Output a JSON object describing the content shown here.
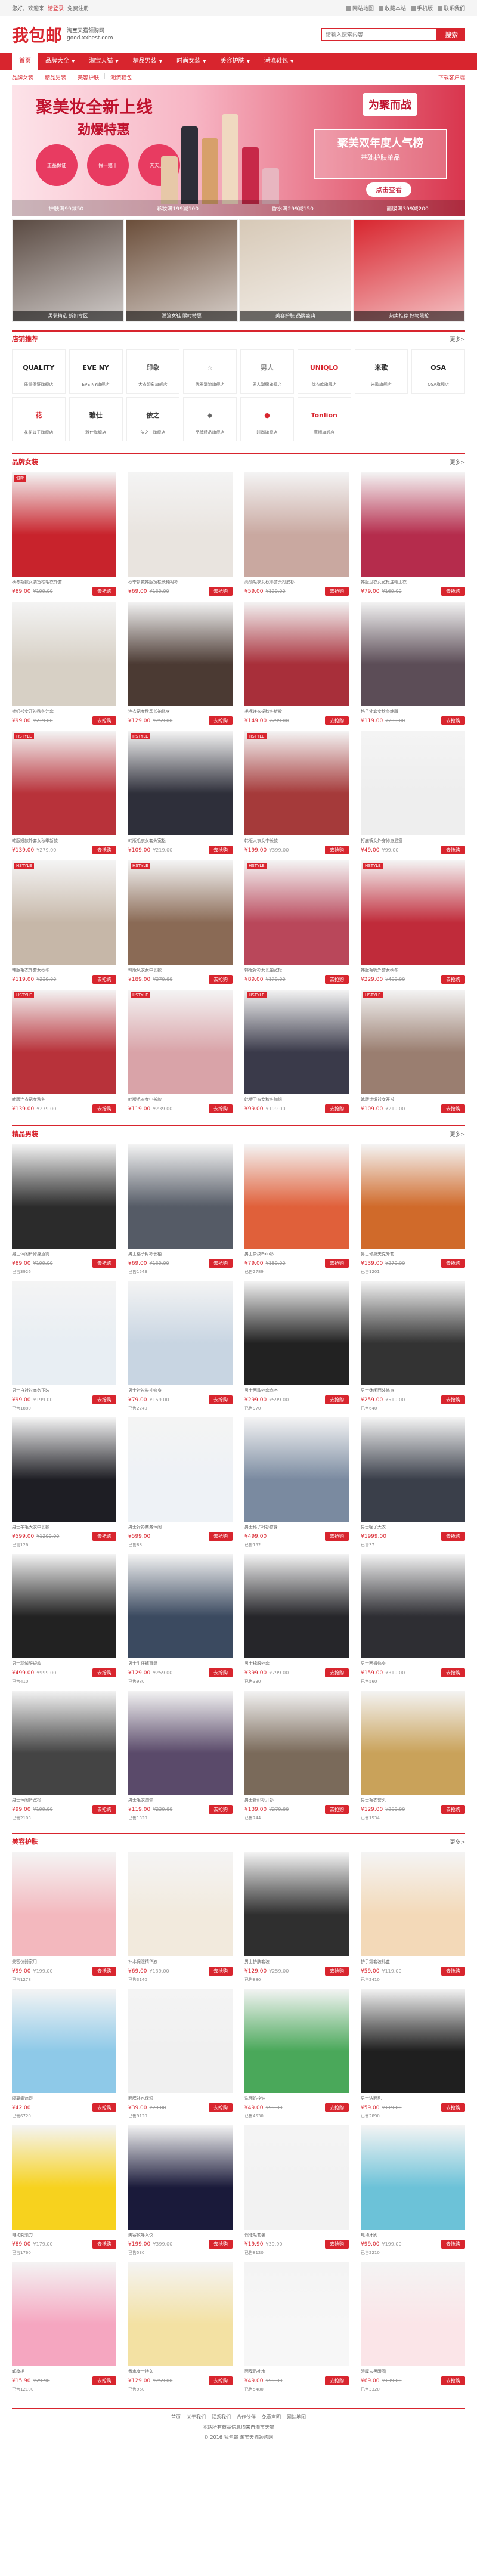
{
  "topbar": {
    "greeting": "您好，欢迎来",
    "login": "请登录",
    "register": "免费注册",
    "right_links": [
      "网站地图",
      "收藏本站",
      "手机版",
      "联系我们"
    ]
  },
  "header": {
    "logo": "我包邮",
    "subtitle1": "淘宝天猫领购网",
    "subtitle2": "good.xxbest.com",
    "search_placeholder": "请输入搜索内容",
    "search_button": "搜索"
  },
  "nav": {
    "items": [
      {
        "label": "首页",
        "active": true
      },
      {
        "label": "品牌大全",
        "active": false
      },
      {
        "label": "淘宝天猫",
        "active": false
      },
      {
        "label": "精品男装",
        "active": false
      },
      {
        "label": "时尚女装",
        "active": false
      },
      {
        "label": "美容护肤",
        "active": false
      },
      {
        "label": "潮流鞋包",
        "active": false
      }
    ]
  },
  "subnav": {
    "crumbs": [
      "品牌女装",
      "精品男装",
      "美容护肤",
      "潮流鞋包"
    ],
    "right": "下载客户端"
  },
  "banner": {
    "headline": "聚美妆全新上线",
    "subline": "劲爆特惠",
    "badges": [
      "正品保证",
      "假一赔十",
      "天天上新"
    ],
    "brand_tag": "为聚而战",
    "rank_line1": "聚美双年度人气榜",
    "rank_line2": "基础护肤单品",
    "cta": "点击查看",
    "strip": [
      "护肤满99减50",
      "彩妆满199减100",
      "香水满299减150",
      "面膜满399减200"
    ]
  },
  "promos": [
    {
      "label": "男装精选 折扣专区",
      "color": "#5a4a42"
    },
    {
      "label": "潮流女鞋 限时特惠",
      "color": "#6b4e3a"
    },
    {
      "label": "美容护肤 品牌盛典",
      "color": "#d7c9b7"
    },
    {
      "label": "热卖推荐 好物限抢",
      "color": "#d8252e"
    }
  ],
  "brand_section": {
    "title": "店铺推荐",
    "more": "更多>",
    "brands": [
      {
        "logo": "QUALITY",
        "name": "质量保证旗舰店",
        "color": "#222"
      },
      {
        "logo": "EVE NY",
        "name": "EVE NY旗舰店",
        "color": "#222"
      },
      {
        "logo": "印象",
        "name": "大衣印象旗舰店",
        "color": "#555"
      },
      {
        "logo": "☆",
        "name": "优雅潮流旗舰店",
        "color": "#888"
      },
      {
        "logo": "男人",
        "name": "男人潮牌旗舰店",
        "color": "#888"
      },
      {
        "logo": "UNIQLO",
        "name": "优衣库旗舰店",
        "color": "#d8252e"
      },
      {
        "logo": "米歌",
        "name": "米歌旗舰店",
        "color": "#222"
      },
      {
        "logo": "OSA",
        "name": "OSA旗舰店",
        "color": "#222"
      },
      {
        "logo": "花",
        "name": "花花公子旗舰店",
        "color": "#d8252e"
      },
      {
        "logo": "雅仕",
        "name": "雅仕旗舰店",
        "color": "#333"
      },
      {
        "logo": "依之",
        "name": "依之一旗舰店",
        "color": "#444"
      },
      {
        "logo": "◆",
        "name": "品牌精品旗舰店",
        "color": "#666"
      },
      {
        "logo": "●",
        "name": "时尚旗舰店",
        "color": "#d8252e"
      },
      {
        "logo": "Tonlion",
        "name": "唐狮旗舰店",
        "color": "#d8252e"
      }
    ]
  },
  "women": {
    "title": "品牌女装",
    "more": "更多>",
    "products": [
      {
        "title": "秋冬新款女装宽松毛衣外套",
        "price": "¥89.00",
        "old": "¥199.00",
        "color": "#c8232c",
        "tag": "包邮"
      },
      {
        "title": "秋季新款韩版宽松长袖衬衫",
        "price": "¥69.00",
        "old": "¥139.00",
        "color": "#e9e4df",
        "tag": ""
      },
      {
        "title": "高领毛衣女秋冬套头打底衫",
        "price": "¥59.00",
        "old": "¥129.00",
        "color": "#c9a8a0",
        "tag": ""
      },
      {
        "title": "韩版卫衣女宽松连帽上衣",
        "price": "¥79.00",
        "old": "¥169.00",
        "color": "#b52c4c",
        "tag": ""
      },
      {
        "title": "针织衫女开衫秋冬外套",
        "price": "¥99.00",
        "old": "¥219.00",
        "color": "#d7d0c5",
        "tag": ""
      },
      {
        "title": "连衣裙女秋季长袖修身",
        "price": "¥129.00",
        "old": "¥259.00",
        "color": "#4b3a33",
        "tag": ""
      },
      {
        "title": "毛呢连衣裙秋冬新款",
        "price": "¥149.00",
        "old": "¥299.00",
        "color": "#a82f3a",
        "tag": ""
      },
      {
        "title": "格子外套女秋冬韩版",
        "price": "¥119.00",
        "old": "¥239.00",
        "color": "#5c4d57",
        "tag": ""
      },
      {
        "title": "韩版短款外套女秋季新款",
        "price": "¥139.00",
        "old": "¥279.00",
        "color": "#b8323a",
        "tag": "HSTYLE"
      },
      {
        "title": "韩版毛衣女套头宽松",
        "price": "¥109.00",
        "old": "¥219.00",
        "color": "#2e2f3a",
        "tag": "HSTYLE"
      },
      {
        "title": "韩版大衣女中长款",
        "price": "¥199.00",
        "old": "¥399.00",
        "color": "#a53a3a",
        "tag": "HSTYLE"
      },
      {
        "title": "打底裤女外穿修身显瘦",
        "price": "¥49.00",
        "old": "¥99.00",
        "color": "#eeeeee",
        "tag": ""
      },
      {
        "title": "韩版毛衣外套女秋冬",
        "price": "¥119.00",
        "old": "¥239.00",
        "color": "#c6b7a8",
        "tag": "HSTYLE"
      },
      {
        "title": "韩版风衣女中长款",
        "price": "¥189.00",
        "old": "¥379.00",
        "color": "#8a6a55",
        "tag": "HSTYLE"
      },
      {
        "title": "韩版衬衫女长袖宽松",
        "price": "¥89.00",
        "old": "¥179.00",
        "color": "#b9475a",
        "tag": "HSTYLE"
      },
      {
        "title": "韩版毛呢外套女秋冬",
        "price": "¥229.00",
        "old": "¥459.00",
        "color": "#c02b3a",
        "tag": "HSTYLE"
      },
      {
        "title": "韩版连衣裙女秋冬",
        "price": "¥139.00",
        "old": "¥279.00",
        "color": "#b8323a",
        "tag": "HSTYLE"
      },
      {
        "title": "韩版毛衣女中长款",
        "price": "¥119.00",
        "old": "¥239.00",
        "color": "#d9a3a8",
        "tag": "HSTYLE"
      },
      {
        "title": "韩版卫衣女秋冬加绒",
        "price": "¥99.00",
        "old": "¥199.00",
        "color": "#3a3a4a",
        "tag": "HSTYLE"
      },
      {
        "title": "韩版针织衫女开衫",
        "price": "¥109.00",
        "old": "¥219.00",
        "color": "#9a7e70",
        "tag": "HSTYLE"
      }
    ]
  },
  "men": {
    "title": "精品男装",
    "more": "更多>",
    "products": [
      {
        "title": "男士休闲裤修身直筒",
        "price": "¥89.00",
        "old": "¥199.00",
        "sold": "已售3926",
        "color": "#2b2b2b"
      },
      {
        "title": "男士格子衬衫长袖",
        "price": "¥69.00",
        "old": "¥139.00",
        "sold": "已售1543",
        "color": "#555b66"
      },
      {
        "title": "男士条纹Polo衫",
        "price": "¥79.00",
        "old": "¥159.00",
        "sold": "已售2789",
        "color": "#e0603a"
      },
      {
        "title": "男士修身夹克外套",
        "price": "¥139.00",
        "old": "¥279.00",
        "sold": "已售1201",
        "color": "#d06a2a"
      },
      {
        "title": "男士白衬衫商务正装",
        "price": "¥99.00",
        "old": "¥199.00",
        "sold": "已售1880",
        "color": "#e8eef3"
      },
      {
        "title": "男士衬衫长袖修身",
        "price": "¥79.00",
        "old": "¥159.00",
        "sold": "已售2240",
        "color": "#c8d5e2"
      },
      {
        "title": "男士西装外套商务",
        "price": "¥299.00",
        "old": "¥599.00",
        "sold": "已售970",
        "color": "#222"
      },
      {
        "title": "男士休闲西装修身",
        "price": "¥259.00",
        "old": "¥519.00",
        "sold": "已售640",
        "color": "#333"
      },
      {
        "title": "男士羊毛大衣中长款",
        "price": "¥599.00",
        "old": "¥1299.00",
        "sold": "已售126",
        "color": "#1e1e24"
      },
      {
        "title": "男士衬衫商务休闲",
        "price": "¥599.00",
        "old": "",
        "sold": "已售88",
        "color": "#eef2f6"
      },
      {
        "title": "男士格子衬衫修身",
        "price": "¥499.00",
        "old": "",
        "sold": "已售152",
        "color": "#7a8aa0"
      },
      {
        "title": "男士呢子大衣",
        "price": "¥1999.00",
        "old": "",
        "sold": "已售37",
        "color": "#3a3f4a"
      },
      {
        "title": "男士羽绒服短款",
        "price": "¥499.00",
        "old": "¥999.00",
        "sold": "已售410",
        "color": "#222"
      },
      {
        "title": "男士牛仔裤直筒",
        "price": "¥129.00",
        "old": "¥259.00",
        "sold": "已售980",
        "color": "#3b4a60"
      },
      {
        "title": "男士棉服外套",
        "price": "¥399.00",
        "old": "¥799.00",
        "sold": "已售330",
        "color": "#26262a"
      },
      {
        "title": "男士西裤修身",
        "price": "¥159.00",
        "old": "¥319.00",
        "sold": "已售560",
        "color": "#2e2e33"
      },
      {
        "title": "男士休闲裤宽松",
        "price": "¥99.00",
        "old": "¥199.00",
        "sold": "已售2103",
        "color": "#444"
      },
      {
        "title": "男士毛衣圆领",
        "price": "¥119.00",
        "old": "¥239.00",
        "sold": "已售1320",
        "color": "#5a4a6a"
      },
      {
        "title": "男士针织衫开衫",
        "price": "¥139.00",
        "old": "¥279.00",
        "sold": "已售744",
        "color": "#7a6a5a"
      },
      {
        "title": "男士毛衣套头",
        "price": "¥129.00",
        "old": "¥259.00",
        "sold": "已售1534",
        "color": "#c9a25a"
      }
    ]
  },
  "beauty": {
    "title": "美容护肤",
    "more": "更多>",
    "products": [
      {
        "title": "美容仪器家用",
        "price": "¥99.00",
        "old": "¥199.00",
        "sold": "已售1278",
        "color": "#f3b8be"
      },
      {
        "title": "补水保湿精华液",
        "price": "¥69.00",
        "old": "¥139.00",
        "sold": "已售3140",
        "color": "#f2eadd"
      },
      {
        "title": "男士护肤套装",
        "price": "¥129.00",
        "old": "¥259.00",
        "sold": "已售880",
        "color": "#2f2f2f"
      },
      {
        "title": "护手霜套装礼盒",
        "price": "¥59.00",
        "old": "¥119.00",
        "sold": "已售2410",
        "color": "#f3d9b8"
      },
      {
        "title": "隔离霜遮瑕",
        "price": "¥42.00",
        "old": "",
        "sold": "已售6720",
        "color": "#8ec9e8"
      },
      {
        "title": "面膜补水保湿",
        "price": "¥39.00",
        "old": "¥79.00",
        "sold": "已售9120",
        "color": "#f0f0f0"
      },
      {
        "title": "洗面奶控油",
        "price": "¥49.00",
        "old": "¥99.00",
        "sold": "已售4530",
        "color": "#4aa85a"
      },
      {
        "title": "男士洁面乳",
        "price": "¥59.00",
        "old": "¥119.00",
        "sold": "已售2890",
        "color": "#1f1f1f"
      },
      {
        "title": "电动剃须刀",
        "price": "¥89.00",
        "old": "¥179.00",
        "sold": "已售1760",
        "color": "#f7d21e"
      },
      {
        "title": "美容仪导入仪",
        "price": "¥199.00",
        "old": "¥399.00",
        "sold": "已售530",
        "color": "#1a1a3a"
      },
      {
        "title": "假睫毛套装",
        "price": "¥19.90",
        "old": "¥39.90",
        "sold": "已售8120",
        "color": "#f2f2f2"
      },
      {
        "title": "电动牙刷",
        "price": "¥99.00",
        "old": "¥199.00",
        "sold": "已售2210",
        "color": "#6cc2d8"
      },
      {
        "title": "卸妆棉",
        "price": "¥15.90",
        "old": "¥29.90",
        "sold": "已售12100",
        "color": "#f5a6c0"
      },
      {
        "title": "香水女士持久",
        "price": "¥129.00",
        "old": "¥259.00",
        "sold": "已售960",
        "color": "#f3e1a3"
      },
      {
        "title": "面膜贴补水",
        "price": "¥49.00",
        "old": "¥99.00",
        "sold": "已售5480",
        "color": "#f7f7f7"
      },
      {
        "title": "眼膜去黑眼圈",
        "price": "¥69.00",
        "old": "¥139.00",
        "sold": "已售3320",
        "color": "#fbe5e8"
      }
    ]
  },
  "footer": {
    "links": [
      "首页",
      "关于我们",
      "联系我们",
      "合作伙伴",
      "免责声明",
      "网站地图"
    ],
    "line1": "本站所有商品信息均来自淘宝天猫",
    "copyright": "© 2016 我包邮 淘宝天猫领购网"
  }
}
